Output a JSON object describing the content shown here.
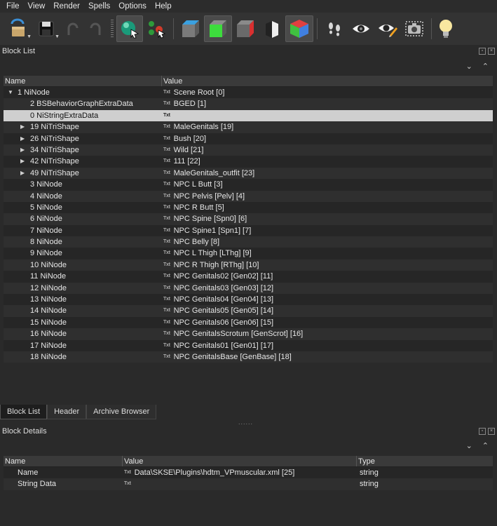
{
  "menu": [
    "File",
    "View",
    "Render",
    "Spells",
    "Options",
    "Help"
  ],
  "block_list": {
    "title": "Block List",
    "columns": [
      "Name",
      "Value"
    ],
    "rows": [
      {
        "name": "1 NiNode",
        "value": "Scene Root [0]",
        "level": 0,
        "expander": "expanded",
        "txt": true
      },
      {
        "name": "2 BSBehaviorGraphExtraData",
        "value": "BGED [1]",
        "level": 1,
        "expander": "",
        "txt": true
      },
      {
        "name": "0 NiStringExtraData",
        "value": "",
        "level": 1,
        "expander": "",
        "txt": true,
        "selected": true
      },
      {
        "name": "19 NiTriShape",
        "value": "MaleGenitals [19]",
        "level": 1,
        "expander": "collapsed",
        "txt": true
      },
      {
        "name": "26 NiTriShape",
        "value": "Bush [20]",
        "level": 1,
        "expander": "collapsed",
        "txt": true
      },
      {
        "name": "34 NiTriShape",
        "value": "Wild [21]",
        "level": 1,
        "expander": "collapsed",
        "txt": true
      },
      {
        "name": "42 NiTriShape",
        "value": "111 [22]",
        "level": 1,
        "expander": "collapsed",
        "txt": true
      },
      {
        "name": "49 NiTriShape",
        "value": "MaleGenitals_outfit [23]",
        "level": 1,
        "expander": "collapsed",
        "txt": true
      },
      {
        "name": "3 NiNode",
        "value": "NPC L Butt [3]",
        "level": 1,
        "expander": "",
        "txt": true
      },
      {
        "name": "4 NiNode",
        "value": "NPC Pelvis [Pelv] [4]",
        "level": 1,
        "expander": "",
        "txt": true
      },
      {
        "name": "5 NiNode",
        "value": "NPC R Butt [5]",
        "level": 1,
        "expander": "",
        "txt": true
      },
      {
        "name": "6 NiNode",
        "value": "NPC Spine [Spn0] [6]",
        "level": 1,
        "expander": "",
        "txt": true
      },
      {
        "name": "7 NiNode",
        "value": "NPC Spine1 [Spn1] [7]",
        "level": 1,
        "expander": "",
        "txt": true
      },
      {
        "name": "8 NiNode",
        "value": "NPC Belly [8]",
        "level": 1,
        "expander": "",
        "txt": true
      },
      {
        "name": "9 NiNode",
        "value": "NPC L Thigh [LThg] [9]",
        "level": 1,
        "expander": "",
        "txt": true
      },
      {
        "name": "10 NiNode",
        "value": "NPC R Thigh [RThg] [10]",
        "level": 1,
        "expander": "",
        "txt": true
      },
      {
        "name": "11 NiNode",
        "value": "NPC Genitals02 [Gen02] [11]",
        "level": 1,
        "expander": "",
        "txt": true
      },
      {
        "name": "12 NiNode",
        "value": "NPC Genitals03 [Gen03] [12]",
        "level": 1,
        "expander": "",
        "txt": true
      },
      {
        "name": "13 NiNode",
        "value": "NPC Genitals04 [Gen04] [13]",
        "level": 1,
        "expander": "",
        "txt": true
      },
      {
        "name": "14 NiNode",
        "value": "NPC Genitals05 [Gen05] [14]",
        "level": 1,
        "expander": "",
        "txt": true
      },
      {
        "name": "15 NiNode",
        "value": "NPC Genitals06 [Gen06] [15]",
        "level": 1,
        "expander": "",
        "txt": true
      },
      {
        "name": "16 NiNode",
        "value": "NPC GenitalsScrotum [GenScrot] [16]",
        "level": 1,
        "expander": "",
        "txt": true
      },
      {
        "name": "17 NiNode",
        "value": "NPC Genitals01 [Gen01] [17]",
        "level": 1,
        "expander": "",
        "txt": true
      },
      {
        "name": "18 NiNode",
        "value": "NPC GenitalsBase [GenBase] [18]",
        "level": 1,
        "expander": "",
        "txt": true
      }
    ]
  },
  "bottom_tabs": [
    {
      "label": "Block List",
      "active": true
    },
    {
      "label": "Header",
      "active": false
    },
    {
      "label": "Archive Browser",
      "active": false
    }
  ],
  "splitter_text": "......",
  "txt_icon_label": "Txt",
  "block_details": {
    "title": "Block Details",
    "columns": [
      "Name",
      "Value",
      "Type"
    ],
    "rows": [
      {
        "name": "Name",
        "value": "Data\\SKSE\\Plugins\\hdtm_VPmuscular.xml [25]",
        "type": "string"
      },
      {
        "name": "String Data",
        "value": "",
        "type": "string"
      }
    ]
  },
  "toolbar_icons": [
    "open-icon",
    "save-icon",
    "undo-icon",
    "redo-icon",
    "sphere-cursor-icon",
    "select-nodes-icon",
    "cube-top-icon",
    "cube-front-icon",
    "cube-side-icon",
    "cube-half-icon",
    "cube-color-icon",
    "footsteps-icon",
    "eye-icon",
    "eye-pencil-icon",
    "screenshot-icon",
    "lightbulb-icon"
  ]
}
